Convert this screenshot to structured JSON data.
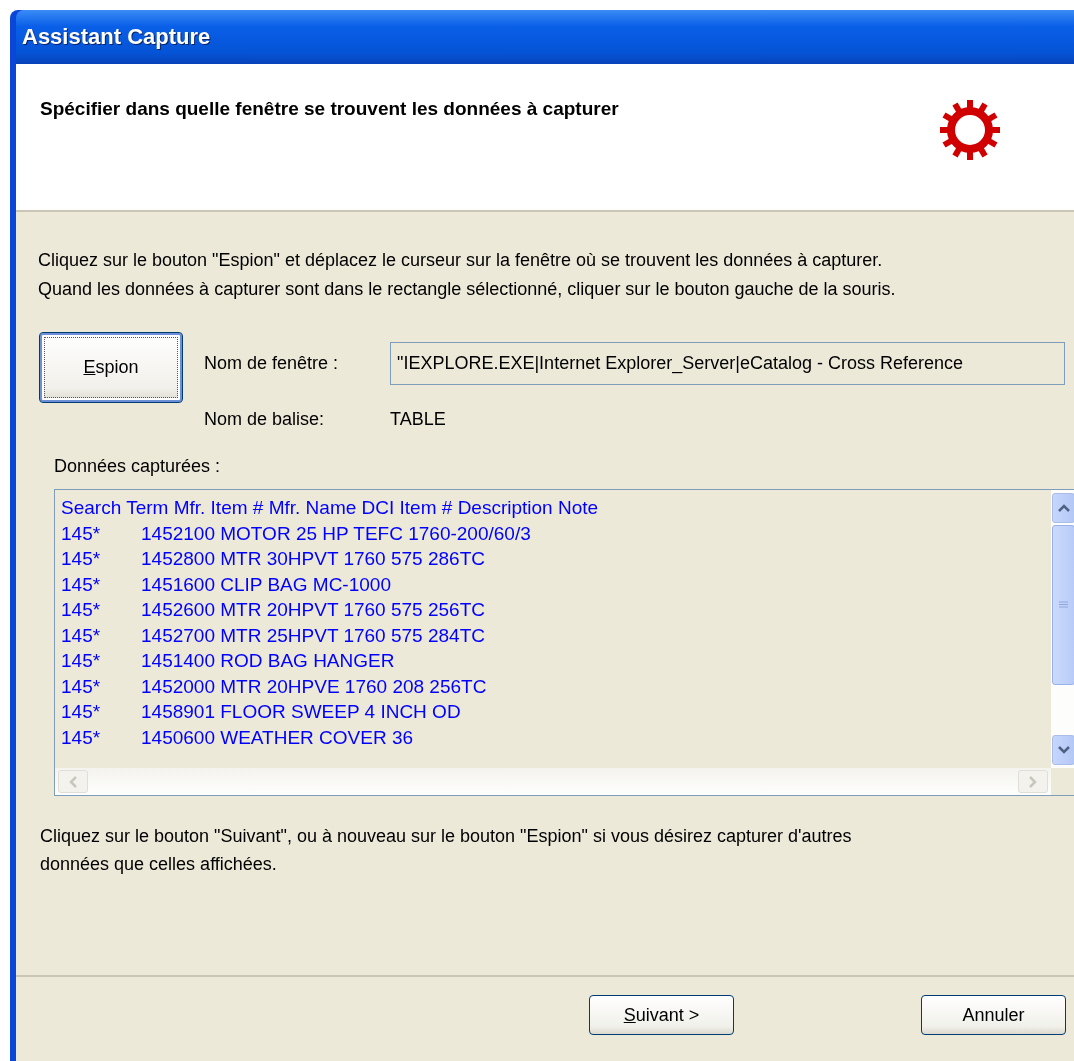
{
  "window": {
    "title": "Assistant Capture"
  },
  "header": {
    "heading": "Spécifier dans quelle fenêtre se trouvent les données à capturer"
  },
  "instructions": "Cliquez sur le bouton \"Espion\" et déplacez le curseur sur la fenêtre où se trouvent les données à capturer.\nQuand les données à capturer sont dans le rectangle sélectionné, cliquer sur le bouton gauche de la souris.",
  "spy_button": {
    "access_key": "E",
    "label_rest": "spion"
  },
  "window_name": {
    "label": "Nom de fenêtre :",
    "value": "\"IEXPLORE.EXE|Internet Explorer_Server|eCatalog - Cross Reference"
  },
  "tag_name": {
    "label": "Nom de balise:",
    "value": "TABLE"
  },
  "captured": {
    "label": "Données capturées :",
    "header_line": "Search Term Mfr. Item # Mfr. Name DCI Item # Description Note",
    "rows": [
      {
        "search_term": "145*",
        "text": "1452100 MOTOR 25 HP TEFC 1760-200/60/3"
      },
      {
        "search_term": "145*",
        "text": "1452800 MTR 30HPVT 1760 575 286TC"
      },
      {
        "search_term": "145*",
        "text": "1451600 CLIP BAG MC-1000"
      },
      {
        "search_term": "145*",
        "text": "1452600 MTR 20HPVT 1760 575 256TC"
      },
      {
        "search_term": "145*",
        "text": "1452700 MTR 25HPVT 1760 575 284TC"
      },
      {
        "search_term": "145*",
        "text": "1451400 ROD BAG HANGER"
      },
      {
        "search_term": "145*",
        "text": "1452000 MTR 20HPVE 1760 208 256TC"
      },
      {
        "search_term": "145*",
        "text": "1458901 FLOOR SWEEP 4 INCH OD"
      },
      {
        "search_term": "145*",
        "text": "1450600 WEATHER COVER 36"
      }
    ]
  },
  "footer_note": "Cliquez sur le bouton \"Suivant\", ou à nouveau sur le bouton \"Espion\" si vous désirez capturer d'autres\ndonnées que celles affichées.",
  "buttons": [
    {
      "access_key": "S",
      "label_rest": "uivant >"
    },
    {
      "label": "Annuler"
    }
  ]
}
